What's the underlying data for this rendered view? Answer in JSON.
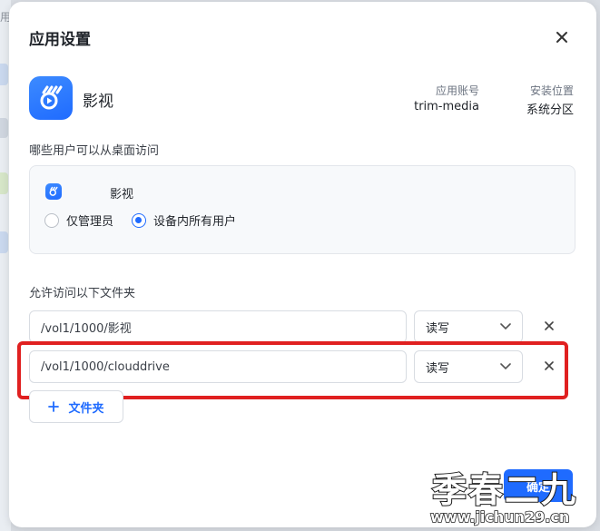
{
  "background": {
    "edge_text": "用"
  },
  "dialog": {
    "title": "应用设置",
    "close_icon": "close-icon"
  },
  "app": {
    "name": "影视",
    "icon": "app-logo-icon",
    "account_label": "应用账号",
    "account_value": "trim-media",
    "location_label": "安装位置",
    "location_value": "系统分区"
  },
  "access": {
    "label": "哪些用户可以从桌面访问",
    "app_name": "影视",
    "options": [
      {
        "label": "仅管理员",
        "checked": false
      },
      {
        "label": "设备内所有用户",
        "checked": true
      }
    ]
  },
  "folders": {
    "label": "允许访问以下文件夹",
    "rows": [
      {
        "path": "/vol1/1000/影视",
        "permission": "读写"
      },
      {
        "path": "/vol1/1000/clouddrive",
        "permission": "读写"
      }
    ],
    "add_label": "文件夹"
  },
  "footer": {
    "confirm_label": "确定"
  },
  "watermark": {
    "title": "季春二九",
    "url": "www.jichun29.cn"
  },
  "colors": {
    "accent": "#1f6bff",
    "highlight": "#e02020"
  }
}
